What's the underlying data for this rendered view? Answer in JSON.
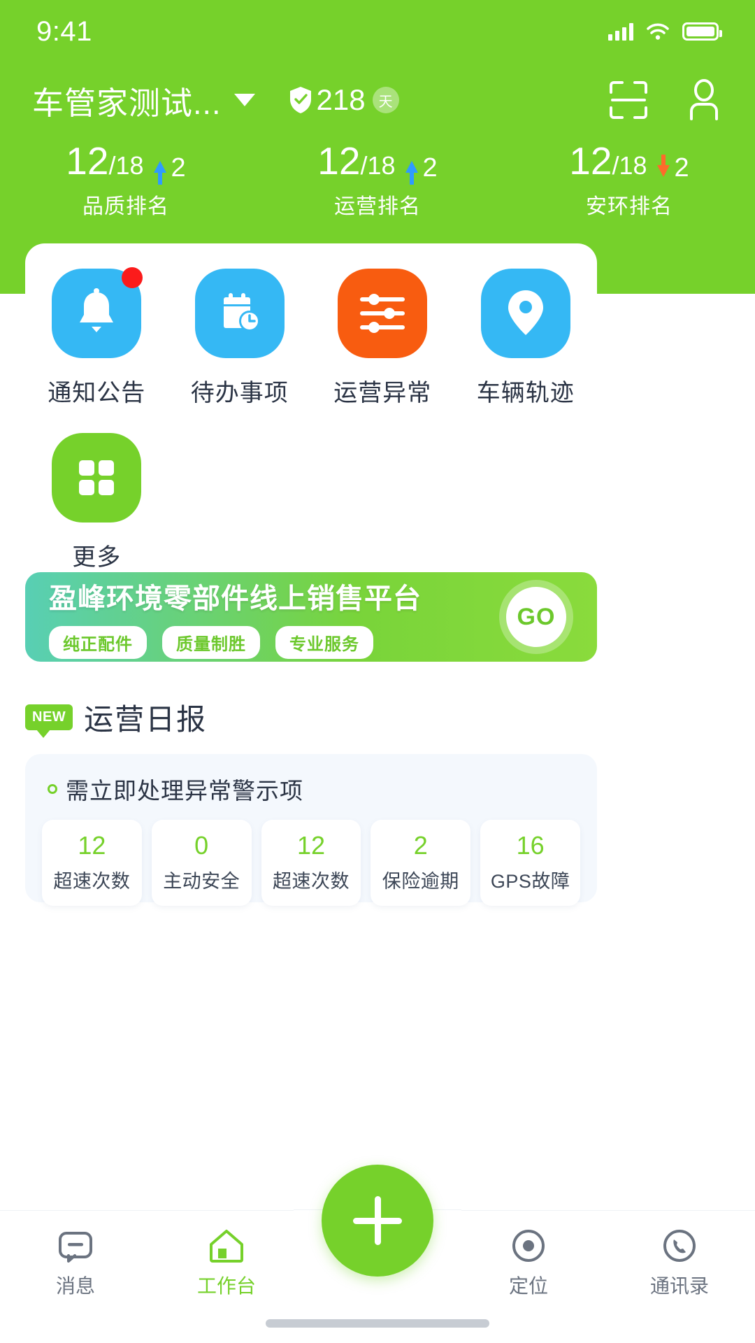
{
  "status_bar": {
    "time": "9:41",
    "signal_icon": "signal-bars-icon",
    "wifi_icon": "wifi-icon",
    "battery_icon": "battery-icon"
  },
  "header": {
    "company_name": "车管家测试...",
    "dropdown_icon": "chevron-down-icon",
    "shield_icon": "shield-check-icon",
    "days_value": "218",
    "days_unit": "天",
    "scan_icon": "scan-qr-icon",
    "profile_icon": "user-profile-icon",
    "accent_color": "#76d12b",
    "rankings": [
      {
        "value": "12",
        "separator": "/",
        "total": "18",
        "trend": "up",
        "delta": "2",
        "label": "品质排名",
        "trend_color": "#2f9bff"
      },
      {
        "value": "12",
        "separator": "/",
        "total": "18",
        "trend": "up",
        "delta": "2",
        "label": "运营排名",
        "trend_color": "#2f9bff"
      },
      {
        "value": "12",
        "separator": "/",
        "total": "18",
        "trend": "down",
        "delta": "2",
        "label": "安环排名",
        "trend_color": "#ff6a2b"
      }
    ]
  },
  "quick_actions": [
    {
      "label": "通知公告",
      "icon": "bell-icon",
      "color": "#35b8f4",
      "badge": true
    },
    {
      "label": "待办事项",
      "icon": "calendar-clock-icon",
      "color": "#35b8f4",
      "badge": false
    },
    {
      "label": "运营异常",
      "icon": "sliders-icon",
      "color": "#f85c10",
      "badge": false
    },
    {
      "label": "车辆轨迹",
      "icon": "map-pin-icon",
      "color": "#35b8f4",
      "badge": false
    },
    {
      "label": "更多",
      "icon": "grid-squares-icon",
      "color": "#76d12b",
      "badge": false
    }
  ],
  "banner": {
    "title": "盈峰环境零部件线上销售平台",
    "tags": [
      "纯正配件",
      "质量制胜",
      "专业服务"
    ],
    "cta_label": "GO"
  },
  "report": {
    "new_badge": "NEW",
    "title": "运营日报",
    "panel_heading": "需立即处理异常警示项",
    "stats": [
      {
        "value": "12",
        "label": "超速次数"
      },
      {
        "value": "0",
        "label": "主动安全"
      },
      {
        "value": "12",
        "label": "超速次数"
      },
      {
        "value": "2",
        "label": "保险逾期"
      },
      {
        "value": "16",
        "label": "GPS故障"
      }
    ],
    "value_color": "#76d12b"
  },
  "tabbar": {
    "items": [
      {
        "label": "消息",
        "icon": "chat-message-icon",
        "active": false
      },
      {
        "label": "工作台",
        "icon": "home-workbench-icon",
        "active": true
      },
      {
        "label": "定位",
        "icon": "location-target-icon",
        "active": false
      },
      {
        "label": "通讯录",
        "icon": "phone-contacts-icon",
        "active": false
      }
    ],
    "fab_icon": "plus-icon"
  }
}
